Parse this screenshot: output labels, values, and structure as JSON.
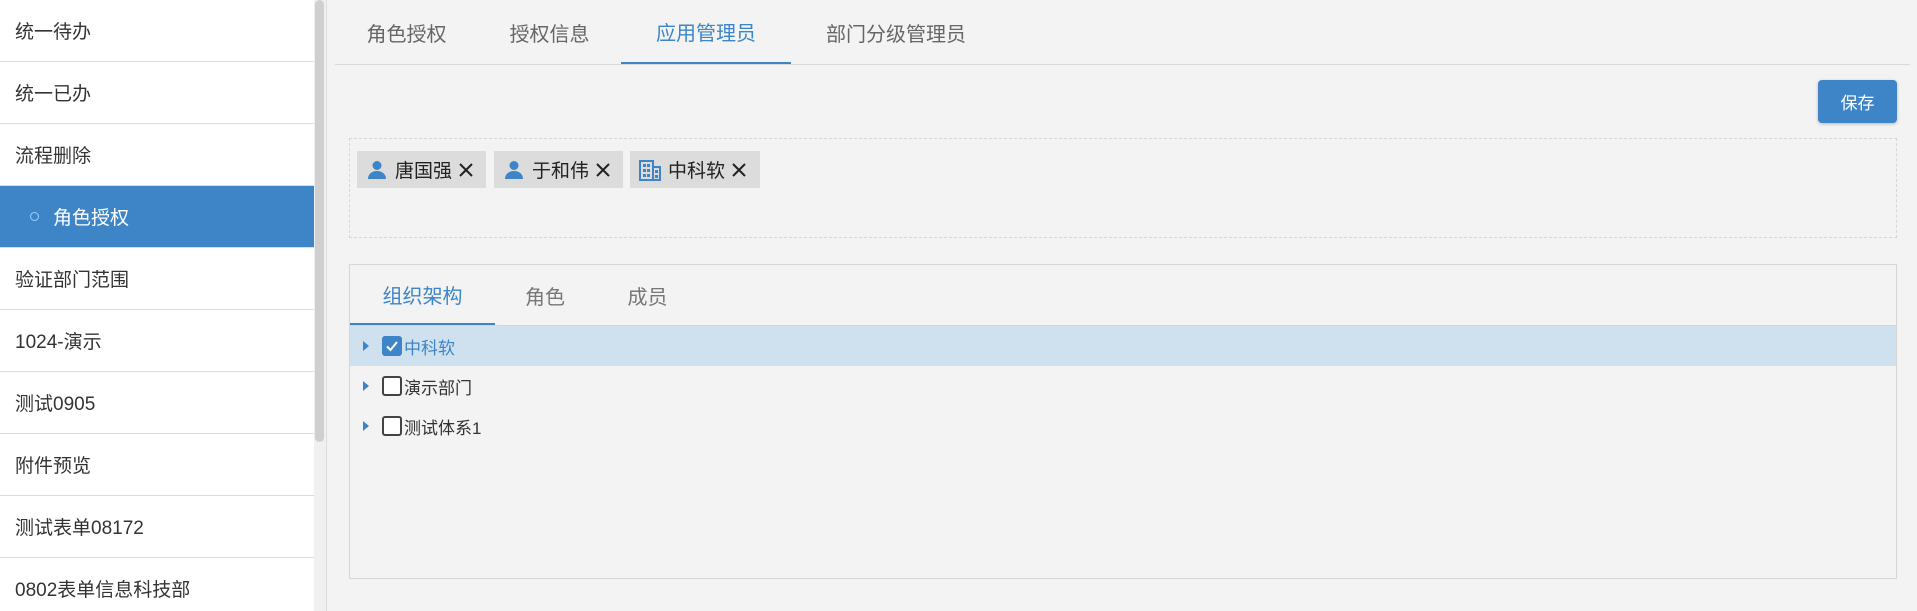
{
  "sidebar": {
    "items": [
      {
        "label": "统一待办"
      },
      {
        "label": "统一已办"
      },
      {
        "label": "流程删除"
      },
      {
        "label": "角色授权",
        "active": true
      },
      {
        "label": "验证部门范围"
      },
      {
        "label": "1024-演示"
      },
      {
        "label": "测试0905"
      },
      {
        "label": "附件预览"
      },
      {
        "label": "测试表单08172"
      },
      {
        "label": "0802表单信息科技部"
      }
    ]
  },
  "tabs": [
    {
      "label": "角色授权"
    },
    {
      "label": "授权信息"
    },
    {
      "label": "应用管理员",
      "active": true
    },
    {
      "label": "部门分级管理员"
    }
  ],
  "toolbar": {
    "save_label": "保存"
  },
  "selected": [
    {
      "label": "唐国强",
      "icon": "user-icon"
    },
    {
      "label": "于和伟",
      "icon": "user-icon"
    },
    {
      "label": "中科软",
      "icon": "building-icon"
    }
  ],
  "inner_tabs": [
    {
      "label": "组织架构",
      "active": true
    },
    {
      "label": "角色"
    },
    {
      "label": "成员"
    }
  ],
  "tree": [
    {
      "label": "中科软",
      "checked": true,
      "selected": true
    },
    {
      "label": "演示部门",
      "checked": false
    },
    {
      "label": "测试体系1",
      "checked": false
    }
  ],
  "colors": {
    "accent": "#3d85c6",
    "row_selected": "#cfe0ef"
  }
}
